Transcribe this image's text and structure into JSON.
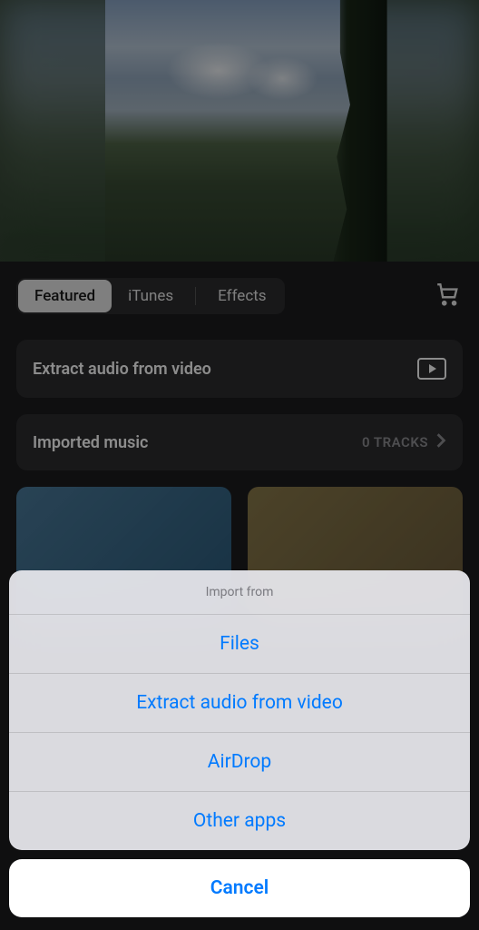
{
  "tabs": {
    "featured": "Featured",
    "itunes": "iTunes",
    "effects": "Effects"
  },
  "cards": {
    "extract": {
      "title": "Extract audio from video"
    },
    "imported": {
      "title": "Imported music",
      "meta": "0 TRACKS"
    }
  },
  "sheet": {
    "title": "Import from",
    "options": {
      "files": "Files",
      "extract": "Extract audio from video",
      "airdrop": "AirDrop",
      "other": "Other apps"
    },
    "cancel": "Cancel"
  }
}
